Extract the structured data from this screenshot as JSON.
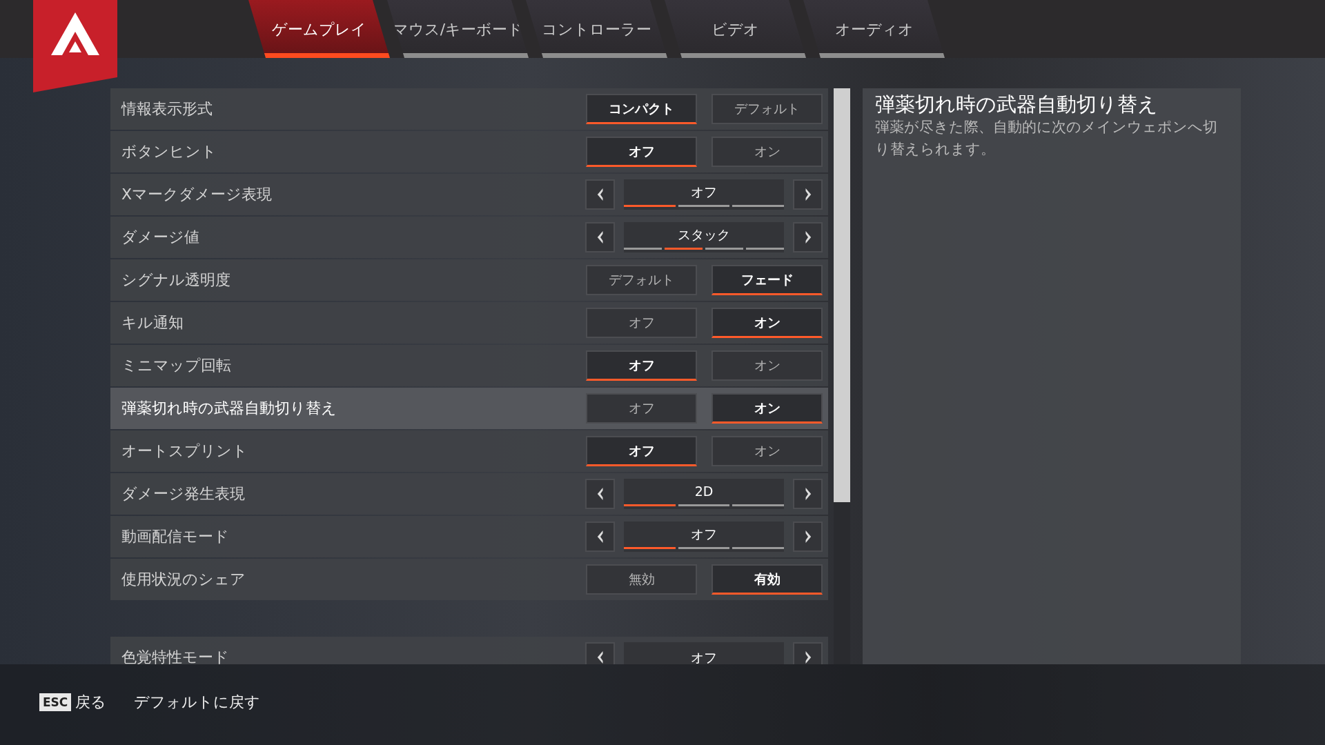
{
  "tabs": [
    {
      "label": "ゲームプレイ",
      "selected": true
    },
    {
      "label": "マウス/キーボード",
      "selected": false
    },
    {
      "label": "コントローラー",
      "selected": false
    },
    {
      "label": "ビデオ",
      "selected": false
    },
    {
      "label": "オーディオ",
      "selected": false
    }
  ],
  "settings": [
    {
      "kind": "toggle",
      "label": "情報表示形式",
      "selected": false,
      "options": [
        {
          "label": "コンパクト",
          "selected": true
        },
        {
          "label": "デフォルト",
          "selected": false
        }
      ]
    },
    {
      "kind": "toggle",
      "label": "ボタンヒント",
      "selected": false,
      "options": [
        {
          "label": "オフ",
          "selected": true
        },
        {
          "label": "オン",
          "selected": false
        }
      ]
    },
    {
      "kind": "cycler",
      "label": "Xマークダメージ表現",
      "selected": false,
      "value": "オフ",
      "segments": [
        {
          "selected": true
        },
        {
          "selected": false
        },
        {
          "selected": false
        }
      ]
    },
    {
      "kind": "cycler",
      "label": "ダメージ値",
      "selected": false,
      "value": "スタック",
      "segments": [
        {
          "selected": false
        },
        {
          "selected": true
        },
        {
          "selected": false
        },
        {
          "selected": false
        }
      ]
    },
    {
      "kind": "toggle",
      "label": "シグナル透明度",
      "selected": false,
      "options": [
        {
          "label": "デフォルト",
          "selected": false
        },
        {
          "label": "フェード",
          "selected": true
        }
      ]
    },
    {
      "kind": "toggle",
      "label": "キル通知",
      "selected": false,
      "options": [
        {
          "label": "オフ",
          "selected": false
        },
        {
          "label": "オン",
          "selected": true
        }
      ]
    },
    {
      "kind": "toggle",
      "label": "ミニマップ回転",
      "selected": false,
      "options": [
        {
          "label": "オフ",
          "selected": true
        },
        {
          "label": "オン",
          "selected": false
        }
      ]
    },
    {
      "kind": "toggle",
      "label": "弾薬切れ時の武器自動切り替え",
      "selected": true,
      "options": [
        {
          "label": "オフ",
          "selected": false
        },
        {
          "label": "オン",
          "selected": true
        }
      ]
    },
    {
      "kind": "toggle",
      "label": "オートスプリント",
      "selected": false,
      "options": [
        {
          "label": "オフ",
          "selected": true
        },
        {
          "label": "オン",
          "selected": false
        }
      ]
    },
    {
      "kind": "cycler",
      "label": "ダメージ発生表現",
      "selected": false,
      "value": "2D",
      "segments": [
        {
          "selected": true
        },
        {
          "selected": false
        },
        {
          "selected": false
        }
      ]
    },
    {
      "kind": "cycler",
      "label": "動画配信モード",
      "selected": false,
      "value": "オフ",
      "segments": [
        {
          "selected": true
        },
        {
          "selected": false
        },
        {
          "selected": false
        }
      ]
    },
    {
      "kind": "toggle",
      "label": "使用状況のシェア",
      "selected": false,
      "options": [
        {
          "label": "無効",
          "selected": false
        },
        {
          "label": "有効",
          "selected": true
        }
      ]
    }
  ],
  "settings_2": [
    {
      "kind": "cycler",
      "label": "色覚特性モード",
      "selected": false,
      "value": "オフ"
    }
  ],
  "description": {
    "title": "弾薬切れ時の武器自動切り替え",
    "text": "弾薬が尽きた際、自動的に次のメインウェポンへ切り替えられます。"
  },
  "footer": {
    "key": "ESC",
    "back": "戻る",
    "reset": "デフォルトに戻す"
  }
}
